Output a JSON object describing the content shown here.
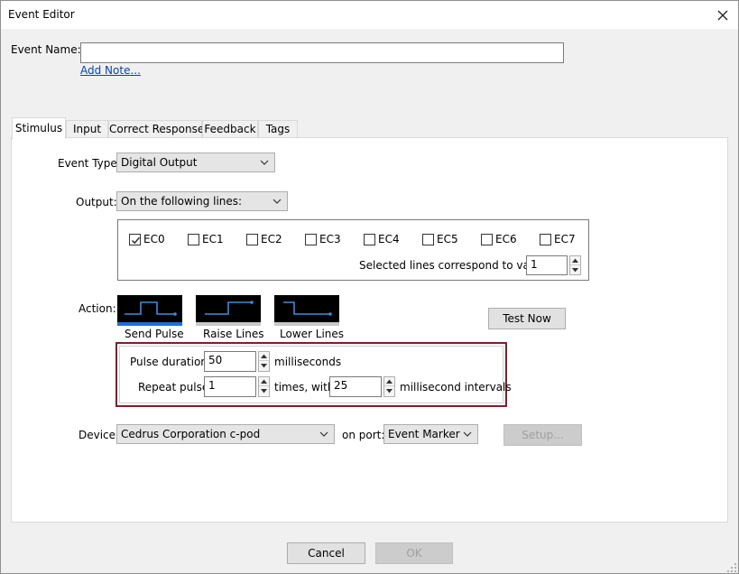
{
  "window": {
    "title": "Event Editor"
  },
  "event_name": {
    "label": "Event Name:",
    "value": "",
    "add_note_link": "Add Note..."
  },
  "tabs": [
    {
      "label": "Stimulus",
      "active": true
    },
    {
      "label": "Input",
      "active": false
    },
    {
      "label": "Correct Response",
      "active": false
    },
    {
      "label": "Feedback",
      "active": false
    },
    {
      "label": "Tags",
      "active": false
    }
  ],
  "event_type": {
    "label": "Event Type:",
    "selected": "Digital Output"
  },
  "output": {
    "label": "Output:",
    "selected": "On the following lines:"
  },
  "lines": [
    {
      "label": "EC0",
      "checked": true
    },
    {
      "label": "EC1",
      "checked": false
    },
    {
      "label": "EC2",
      "checked": false
    },
    {
      "label": "EC3",
      "checked": false
    },
    {
      "label": "EC4",
      "checked": false
    },
    {
      "label": "EC5",
      "checked": false
    },
    {
      "label": "EC6",
      "checked": false
    },
    {
      "label": "EC7",
      "checked": false
    }
  ],
  "selected_lines": {
    "label": "Selected lines correspond to value",
    "value": "1"
  },
  "action": {
    "label": "Action:",
    "options": [
      {
        "label": "Send Pulse",
        "selected": true,
        "icon": "send-pulse-icon"
      },
      {
        "label": "Raise Lines",
        "selected": false,
        "icon": "raise-lines-icon"
      },
      {
        "label": "Lower Lines",
        "selected": false,
        "icon": "lower-lines-icon"
      }
    ],
    "test_now_label": "Test Now"
  },
  "pulse": {
    "duration_label": "Pulse duration:",
    "duration_value": "50",
    "duration_unit": "milliseconds",
    "repeat_label": "Repeat pulse:",
    "repeat_value": "1",
    "times_with_label": "times, with",
    "interval_value": "25",
    "interval_unit": "millisecond intervals"
  },
  "device": {
    "label": "Device:",
    "selected": "Cedrus Corporation c-pod",
    "port_label": "on port:",
    "port_selected": "Event Marker",
    "setup_label": "Setup..."
  },
  "footer": {
    "cancel_label": "Cancel",
    "ok_label": "OK"
  },
  "colors": {
    "accent_blue": "#1e6fd9",
    "selection_red": "#7d1f2e",
    "icon_line": "#3d8be0"
  }
}
